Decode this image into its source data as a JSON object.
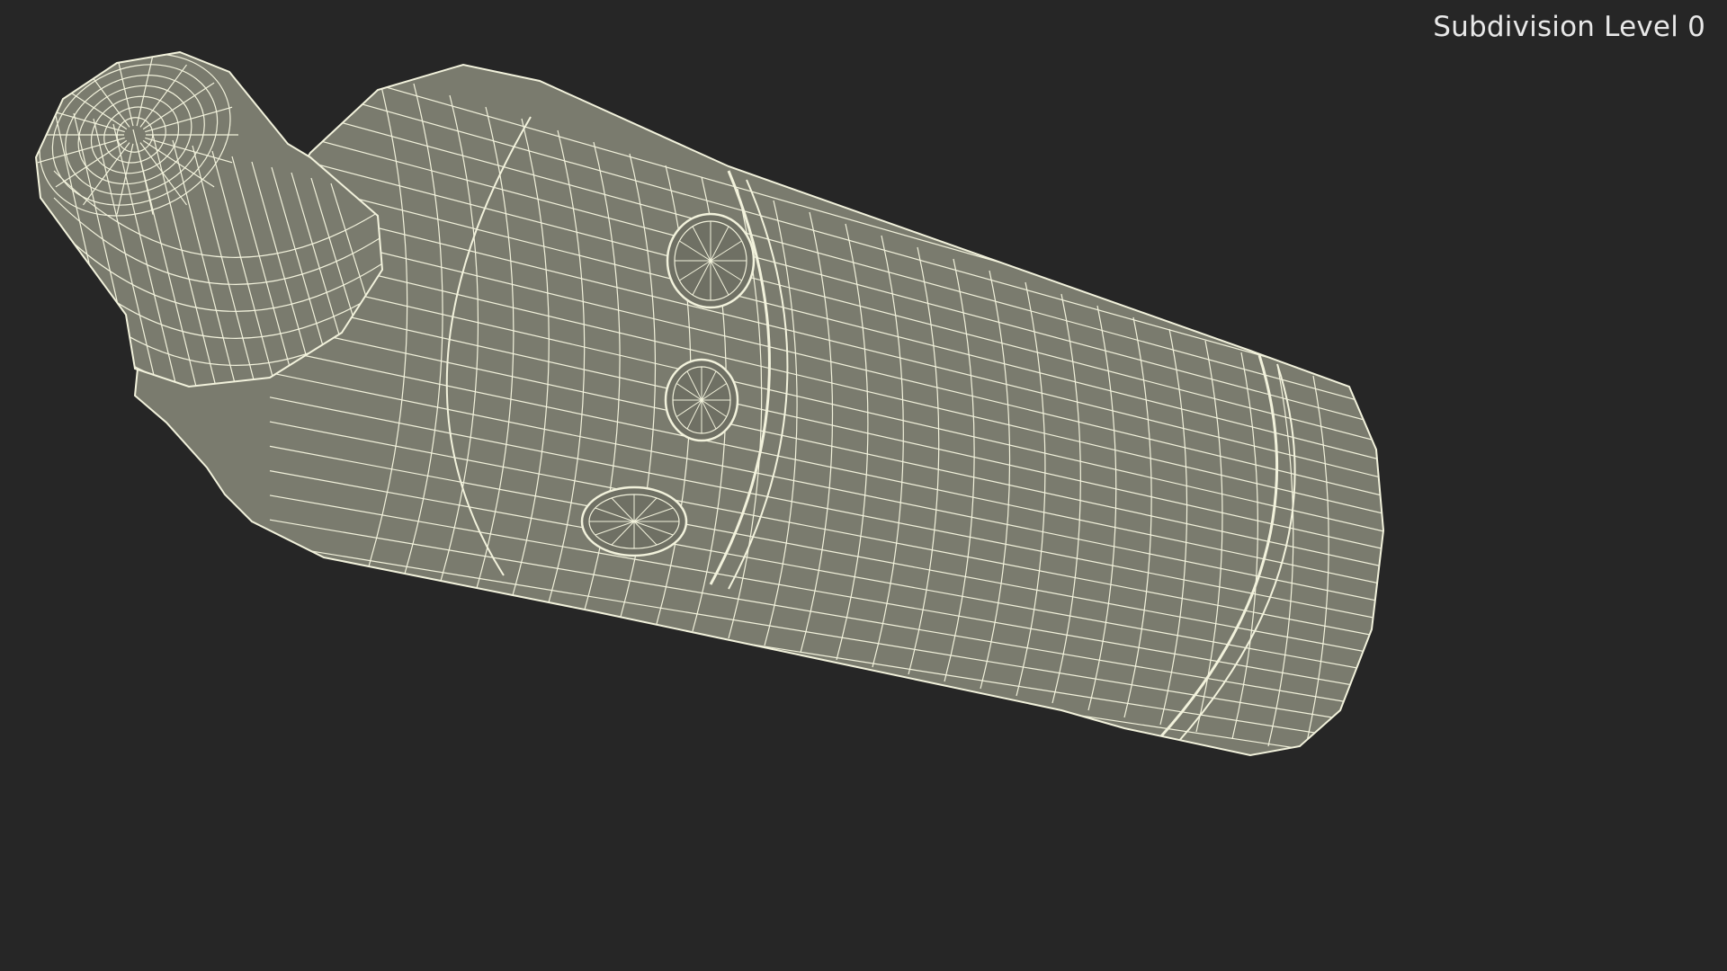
{
  "viewport": {
    "subdivision_label": "Subdivision Level 0",
    "background_color": "#262626",
    "mesh_fill_color": "#7a7b6e",
    "wire_color": "#f2f2dc"
  },
  "model": {
    "name": "cylindrical-part-wireframe"
  }
}
